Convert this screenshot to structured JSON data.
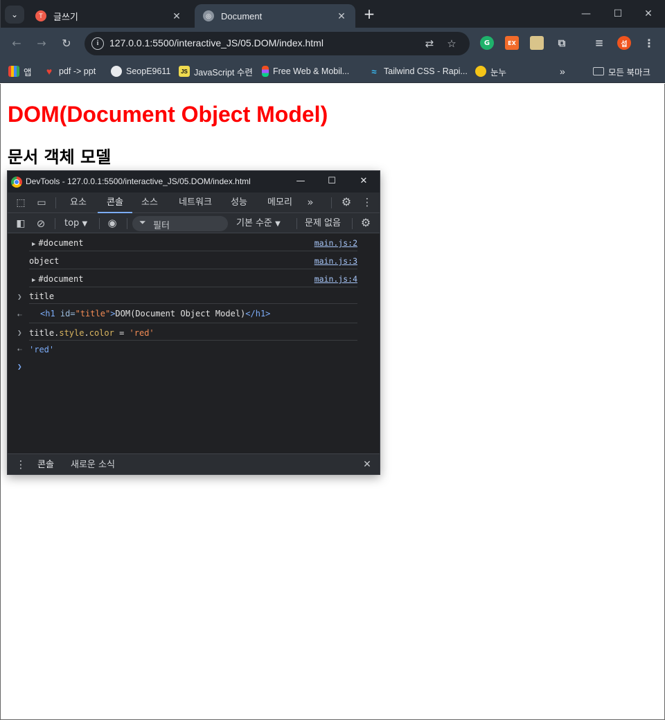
{
  "browser": {
    "tabs": [
      {
        "title": "글쓰기",
        "favicon": "T"
      },
      {
        "title": "Document",
        "favicon": ""
      }
    ],
    "url": "127.0.0.1:5500/interactive_JS/05.DOM/index.html",
    "profile_initial": "섭",
    "bookmarks": [
      {
        "label": "앱"
      },
      {
        "label": "pdf -> ppt"
      },
      {
        "label": "SeopE9611"
      },
      {
        "label": "JavaScript 수련"
      },
      {
        "label": "Free Web & Mobil..."
      },
      {
        "label": "Tailwind CSS - Rapi..."
      },
      {
        "label": "눈누"
      }
    ],
    "all_bookmarks": "모든 북마크",
    "ext_label": "EX"
  },
  "page": {
    "h1": "DOM(Document Object Model)",
    "h1_color": "#ff0000",
    "h2": "문서 객체 모델"
  },
  "devtools": {
    "title": "DevTools - 127.0.0.1:5500/interactive_JS/05.DOM/index.html",
    "tabs": [
      "요소",
      "콘솔",
      "소스",
      "네트워크",
      "성능",
      "메모리"
    ],
    "active_tab": "콘솔",
    "context": "top",
    "filter_placeholder": "필터",
    "levels": "기본 수준",
    "issues": "문제 없음",
    "console": {
      "log1": {
        "text": "#document",
        "source": "main.js:2"
      },
      "log2": {
        "text": "object",
        "source": "main.js:3"
      },
      "log3": {
        "text": "#document",
        "source": "main.js:4"
      },
      "input1": "title",
      "output1": {
        "open": "<h1",
        "attr_name": "id=",
        "attr_value": "\"title\"",
        "close": ">",
        "content": "DOM(Document Object Model)",
        "end": "</h1>"
      },
      "input2": {
        "obj": "title",
        "dot1": ".",
        "p1": "style",
        "dot2": ".",
        "p2": "color",
        "op": " = ",
        "val": "'red'"
      },
      "output2": "'red'"
    },
    "drawer": {
      "tabs": [
        "콘솔",
        "새로운 소식"
      ]
    }
  }
}
